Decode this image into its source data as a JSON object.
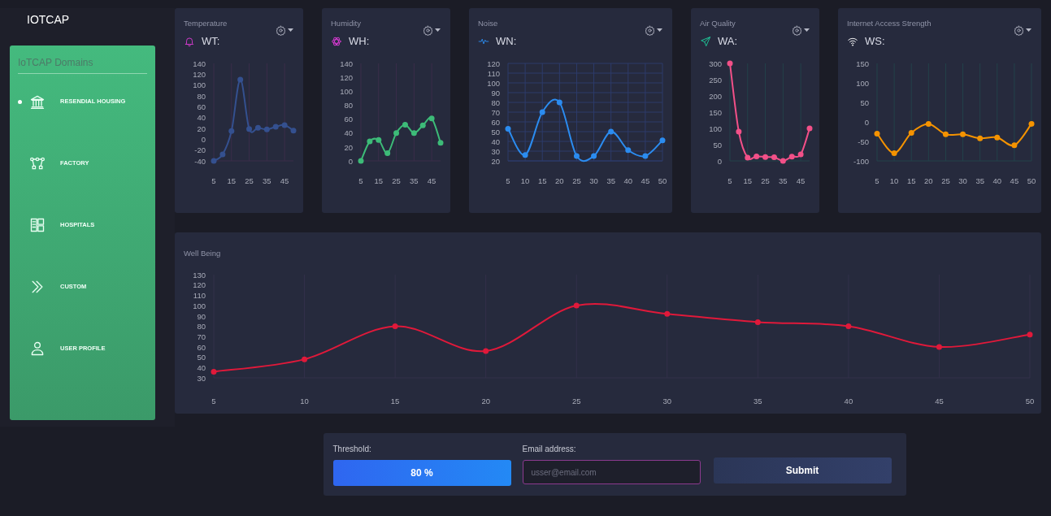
{
  "brand": "IOTCAP",
  "sidebar": {
    "title": "IoTCAP Domains",
    "items": [
      {
        "label": "RESENDIAL HOUSING",
        "selected": true
      },
      {
        "label": "FACTORY",
        "selected": false
      },
      {
        "label": "HOSPITALS",
        "selected": false
      },
      {
        "label": "CUSTOM",
        "selected": false
      },
      {
        "label": "USER PROFILE",
        "selected": false
      }
    ]
  },
  "cards": [
    {
      "title": "Temperature",
      "reading": "WT:",
      "chart_data": {
        "type": "line",
        "grid": "x",
        "x": [
          5,
          10,
          15,
          20,
          25,
          30,
          35,
          40,
          45,
          50
        ],
        "xlim": [
          5,
          50
        ],
        "ylim": [
          -40,
          140
        ],
        "xticks": [
          5,
          15,
          25,
          35,
          45
        ],
        "yticks": [
          -40,
          -20,
          0,
          20,
          40,
          60,
          80,
          100,
          120,
          140
        ],
        "series": [
          {
            "color": "#34508f",
            "marker": "circle",
            "values": [
              -40,
              -28,
              15,
              110,
              19,
              21,
              18,
              23,
              26,
              16
            ]
          }
        ]
      }
    },
    {
      "title": "Humidity",
      "reading": "WH:",
      "chart_data": {
        "type": "line",
        "grid": "x",
        "x": [
          5,
          10,
          15,
          20,
          25,
          30,
          35,
          40,
          45,
          50
        ],
        "xlim": [
          5,
          50
        ],
        "ylim": [
          0,
          140
        ],
        "xticks": [
          5,
          15,
          25,
          35,
          45
        ],
        "yticks": [
          0,
          20,
          40,
          60,
          80,
          100,
          120,
          140
        ],
        "series": [
          {
            "color": "#3dbb78",
            "marker": "circle",
            "values": [
              0,
              28,
              30,
              11,
              40,
              52,
              40,
              51,
              61,
              26
            ]
          }
        ]
      }
    },
    {
      "title": "Noise",
      "reading": "WN:",
      "chart_data": {
        "type": "line",
        "grid": "both",
        "x": [
          5,
          10,
          15,
          20,
          25,
          30,
          35,
          40,
          45,
          50
        ],
        "xlim": [
          5,
          50
        ],
        "ylim": [
          20,
          120
        ],
        "xticks": [
          5,
          10,
          15,
          20,
          25,
          30,
          35,
          40,
          45,
          50
        ],
        "yticks": [
          20,
          30,
          40,
          50,
          60,
          70,
          80,
          90,
          100,
          110,
          120
        ],
        "series": [
          {
            "color": "#2b8cf0",
            "marker": "circle",
            "values": [
              53,
              26,
              70,
              80,
              25,
              25,
              50,
              31,
              25,
              41
            ]
          }
        ]
      }
    },
    {
      "title": "Air Quality",
      "reading": "WA:",
      "chart_data": {
        "type": "line",
        "grid": "x",
        "x": [
          5,
          10,
          15,
          20,
          25,
          30,
          35,
          40,
          45,
          50
        ],
        "xlim": [
          5,
          50
        ],
        "ylim": [
          0,
          300
        ],
        "xticks": [
          5,
          15,
          25,
          35,
          45
        ],
        "yticks": [
          0,
          50,
          100,
          150,
          200,
          250,
          300
        ],
        "series": [
          {
            "color": "#f25088",
            "marker": "circle",
            "values": [
              300,
              90,
              10,
              14,
              12,
              11,
              0,
              13,
              20,
              100
            ]
          }
        ]
      }
    },
    {
      "title": "Internet Access Strength",
      "reading": "WS:",
      "chart_data": {
        "type": "line",
        "grid": "x",
        "x": [
          5,
          10,
          15,
          20,
          25,
          30,
          35,
          40,
          45,
          50
        ],
        "xlim": [
          5,
          50
        ],
        "ylim": [
          -100,
          150
        ],
        "xticks": [
          5,
          10,
          15,
          20,
          25,
          30,
          35,
          40,
          45,
          50
        ],
        "yticks": [
          -100,
          -50,
          0,
          50,
          100,
          150
        ],
        "series": [
          {
            "color": "#f59300",
            "marker": "circle",
            "values": [
              -30,
              -80,
              -28,
              -5,
              -32,
              -32,
              -42,
              -40,
              -60,
              -5
            ]
          }
        ]
      }
    }
  ],
  "well_being": {
    "title": "Well Being",
    "chart_data": {
      "type": "line",
      "grid": "x",
      "x": [
        5,
        10,
        15,
        20,
        25,
        30,
        35,
        40,
        45,
        50
      ],
      "xlim": [
        5,
        50
      ],
      "ylim": [
        30,
        130
      ],
      "xticks": [
        5,
        10,
        15,
        20,
        25,
        30,
        35,
        40,
        45,
        50
      ],
      "yticks": [
        30,
        40,
        50,
        60,
        70,
        80,
        90,
        100,
        110,
        120,
        130
      ],
      "series": [
        {
          "color": "#e0193a",
          "marker": "circle",
          "values": [
            36,
            48,
            80,
            56,
            100,
            92,
            84,
            80,
            60,
            72
          ]
        }
      ]
    }
  },
  "form": {
    "threshold": {
      "label": "Threshold:",
      "value": "80 %"
    },
    "email": {
      "label": "Email address:",
      "placeholder": "usser@email.com"
    },
    "submit": "Submit"
  }
}
